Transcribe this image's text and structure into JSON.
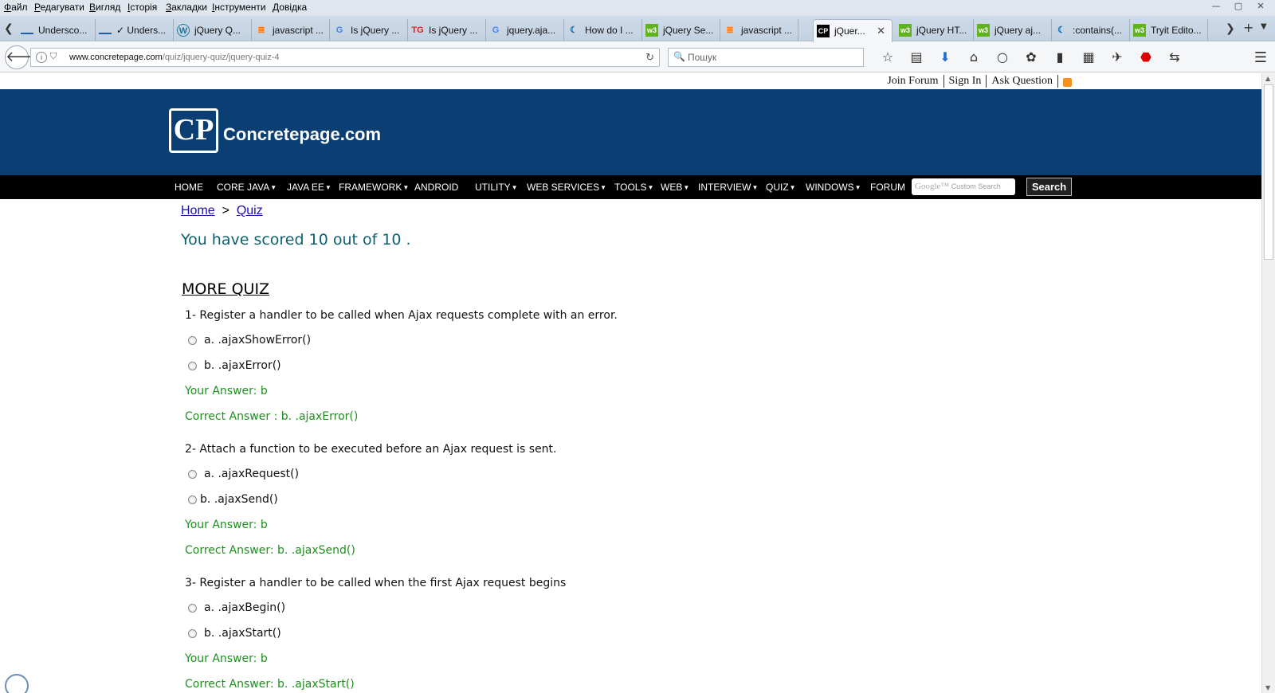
{
  "menubar": {
    "items": [
      "Файл",
      "Редагувати",
      "Вигляд",
      "Історія",
      "Закладки",
      "Інструменти",
      "Довідка"
    ],
    "window_buttons": [
      "—",
      "▢",
      "✕"
    ]
  },
  "tabs": [
    {
      "label": "Undersco...",
      "icon": "underscore-icon"
    },
    {
      "label": "✓ Unders...",
      "icon": "underscore-icon"
    },
    {
      "label": "jQuery Q...",
      "icon": "wordpress-icon"
    },
    {
      "label": "javascript ...",
      "icon": "stackoverflow-icon"
    },
    {
      "label": "Is jQuery ...",
      "icon": "google-icon"
    },
    {
      "label": "Is jQuery ...",
      "icon": "tg-icon"
    },
    {
      "label": "jquery.aja...",
      "icon": "google-icon"
    },
    {
      "label": "How do I ...",
      "icon": "jquery-icon"
    },
    {
      "label": "jQuery Se...",
      "icon": "w3schools-icon"
    },
    {
      "label": "javascript ...",
      "icon": "stackoverflow-icon"
    },
    {
      "label": "jQuer...",
      "icon": "concretepage-icon",
      "active": true
    },
    {
      "label": "jQuery HT...",
      "icon": "w3schools-icon"
    },
    {
      "label": "jQuery aj...",
      "icon": "w3schools-icon"
    },
    {
      "label": ":contains(...",
      "icon": "jquery-icon"
    },
    {
      "label": "Tryit Edito...",
      "icon": "w3schools-icon"
    }
  ],
  "navbar": {
    "url_domain": "www.concretepage.com",
    "url_path": "/quiz/jquery-quiz/jquery-quiz-4",
    "search_placeholder": "Пошук"
  },
  "site": {
    "toplinks": [
      "Join Forum",
      "Sign In",
      "Ask Question"
    ],
    "logo_mark": "CP",
    "logo_text": "Concretepage.com",
    "nav": [
      {
        "label": "HOME",
        "caret": false
      },
      {
        "label": "CORE JAVA",
        "caret": true
      },
      {
        "label": "JAVA EE",
        "caret": true
      },
      {
        "label": "FRAMEWORK",
        "caret": true
      },
      {
        "label": "ANDROID",
        "caret": false
      },
      {
        "label": "UTILITY",
        "caret": true
      },
      {
        "label": "WEB SERVICES",
        "caret": true
      },
      {
        "label": "TOOLS",
        "caret": true
      },
      {
        "label": "WEB",
        "caret": true
      },
      {
        "label": "INTERVIEW",
        "caret": true
      },
      {
        "label": "QUIZ",
        "caret": true
      },
      {
        "label": "WINDOWS",
        "caret": true
      },
      {
        "label": "FORUM",
        "caret": false
      }
    ],
    "cse_brand": "Google™",
    "cse_placeholder": "Custom Search",
    "search_button": "Search"
  },
  "breadcrumb": {
    "home": "Home",
    "sep": ">",
    "quiz": "Quiz"
  },
  "score_text": "You have scored 10 out of 10 .",
  "more_quiz": "MORE QUIZ",
  "questions": [
    {
      "text": "1- Register a handler to be called when Ajax requests complete with an error.",
      "options": [
        "a. .ajaxShowError()",
        "b. .ajaxError()"
      ],
      "your_answer": "Your Answer: b",
      "correct_answer": "Correct Answer : b. .ajaxError()"
    },
    {
      "text": "2- Attach a function to be executed before an Ajax request is sent.",
      "options": [
        "a. .ajaxRequest()",
        "b. .ajaxSend()"
      ],
      "your_answer": "Your Answer: b",
      "correct_answer": "Correct Answer: b. .ajaxSend()"
    },
    {
      "text": "3- Register a handler to be called when the first Ajax request begins",
      "options": [
        "a. .ajaxBegin()",
        "b. .ajaxStart()"
      ],
      "your_answer": "Your Answer: b",
      "correct_answer": "Correct Answer: b. .ajaxStart()"
    }
  ],
  "colors": {
    "header_bg": "#0b3f73",
    "nav_bg": "#000000",
    "score": "#0d5f6e",
    "answer_green": "#1e8f1e",
    "link": "#1a0dab"
  }
}
